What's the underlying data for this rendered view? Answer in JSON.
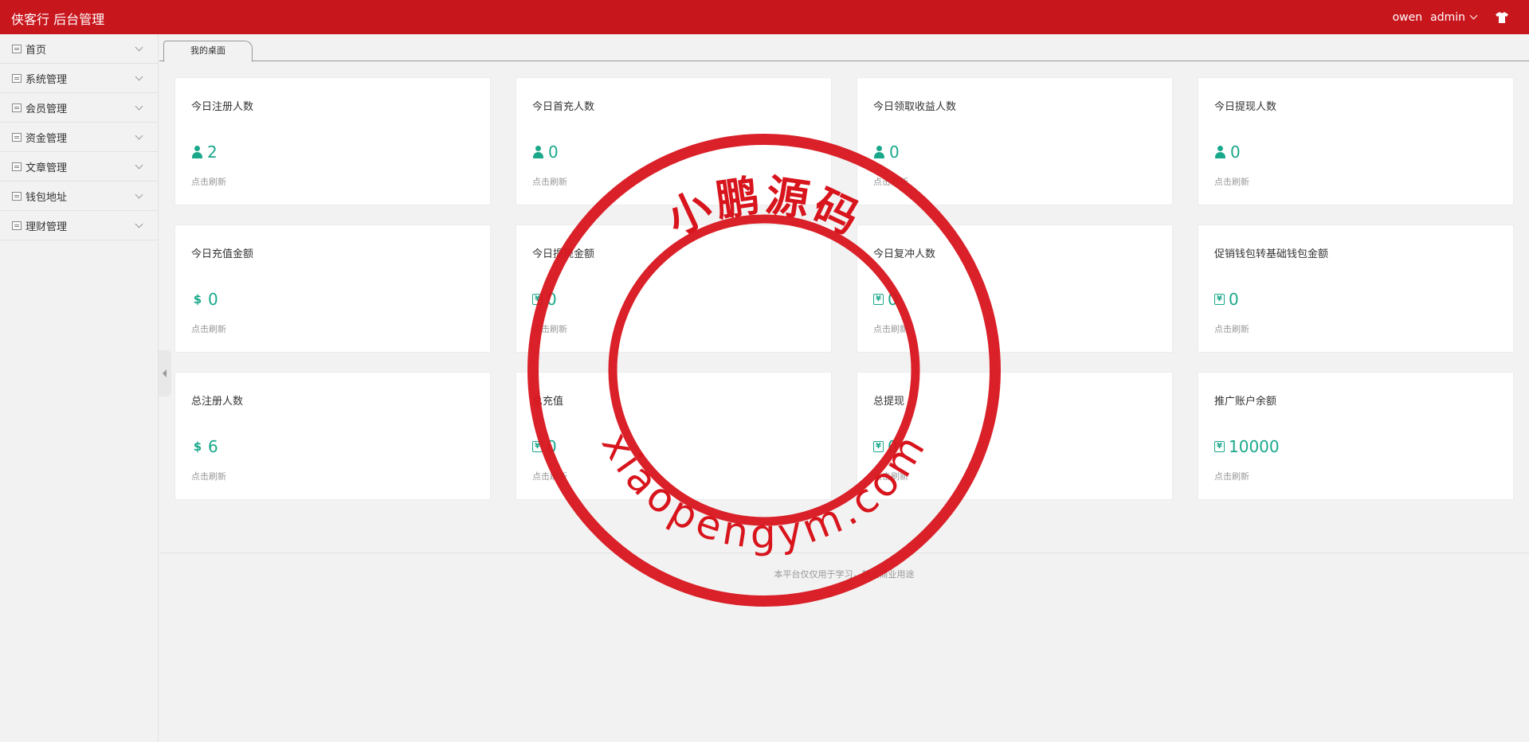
{
  "header": {
    "brand": "侠客行 后台管理",
    "user_name": "owen",
    "admin_label": "admin",
    "shirt_icon": "tshirt-icon",
    "background": "#c8161d"
  },
  "sidebar": {
    "items": [
      {
        "label": "首页",
        "icon": "list-icon"
      },
      {
        "label": "系统管理",
        "icon": "list-icon"
      },
      {
        "label": "会员管理",
        "icon": "list-icon"
      },
      {
        "label": "资金管理",
        "icon": "list-icon"
      },
      {
        "label": "文章管理",
        "icon": "list-icon"
      },
      {
        "label": "钱包地址",
        "icon": "list-icon"
      },
      {
        "label": "理财管理",
        "icon": "list-icon"
      }
    ]
  },
  "tabs": [
    {
      "label": "我的桌面"
    }
  ],
  "cards": [
    {
      "title": "今日注册人数",
      "value": "2",
      "icon": "user-icon",
      "refresh": "点击刷新"
    },
    {
      "title": "今日首充人数",
      "value": "0",
      "icon": "user-icon",
      "refresh": "点击刷新"
    },
    {
      "title": "今日领取收益人数",
      "value": "0",
      "icon": "user-icon",
      "refresh": "点击刷新"
    },
    {
      "title": "今日提现人数",
      "value": "0",
      "icon": "user-icon",
      "refresh": "点击刷新"
    },
    {
      "title": "今日充值金额",
      "value": "0",
      "icon": "dollar-icon",
      "refresh": "点击刷新"
    },
    {
      "title": "今日提现金额",
      "value": "0",
      "icon": "yen-icon",
      "refresh": "点击刷新"
    },
    {
      "title": "今日复冲人数",
      "value": "0",
      "icon": "yen-icon",
      "refresh": "点击刷新"
    },
    {
      "title": "促销钱包转基础钱包金额",
      "value": "0",
      "icon": "yen-icon",
      "refresh": "点击刷新"
    },
    {
      "title": "总注册人数",
      "value": "6",
      "icon": "dollar-icon",
      "refresh": "点击刷新"
    },
    {
      "title": "总充值",
      "value": "0",
      "icon": "yen-icon",
      "refresh": "点击刷新"
    },
    {
      "title": "总提现",
      "value": "0",
      "icon": "yen-icon",
      "refresh": "点击刷新"
    },
    {
      "title": "推广账户余额",
      "value": "10000",
      "icon": "yen-icon",
      "refresh": "点击刷新"
    }
  ],
  "footer": {
    "text": "本平台仅仅用于学习，禁止商业用途"
  },
  "watermark": {
    "top_text": "小鹏源码",
    "bottom_text": "xiaopengym.com",
    "color": "#d8141c"
  },
  "colors": {
    "value_green": "#1aa88b"
  }
}
